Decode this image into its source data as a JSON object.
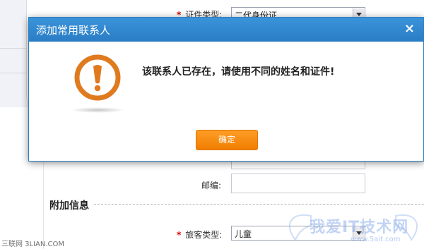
{
  "background": {
    "id_type_label": "证件类型:",
    "id_type_value": "二代身份证",
    "postcode_label": "邮编:",
    "section_title": "附加信息",
    "passenger_type_label": "旅客类型:",
    "passenger_type_value": "儿童",
    "required_mark": "*"
  },
  "dialog": {
    "title": "添加常用联系人",
    "close_glyph": "×",
    "message": "该联系人已存在，请使用不同的姓名和证件!",
    "ok_label": "确定",
    "icon": "exclamation-circle-icon",
    "accent_color": "#2f86cf",
    "icon_color": "#e07a1f",
    "button_color": "#f58a0b"
  },
  "watermarks": {
    "left": "三联网 3LIAN.COM",
    "right": "我爱IT技术网",
    "right_sub": "www.5ait.com"
  }
}
